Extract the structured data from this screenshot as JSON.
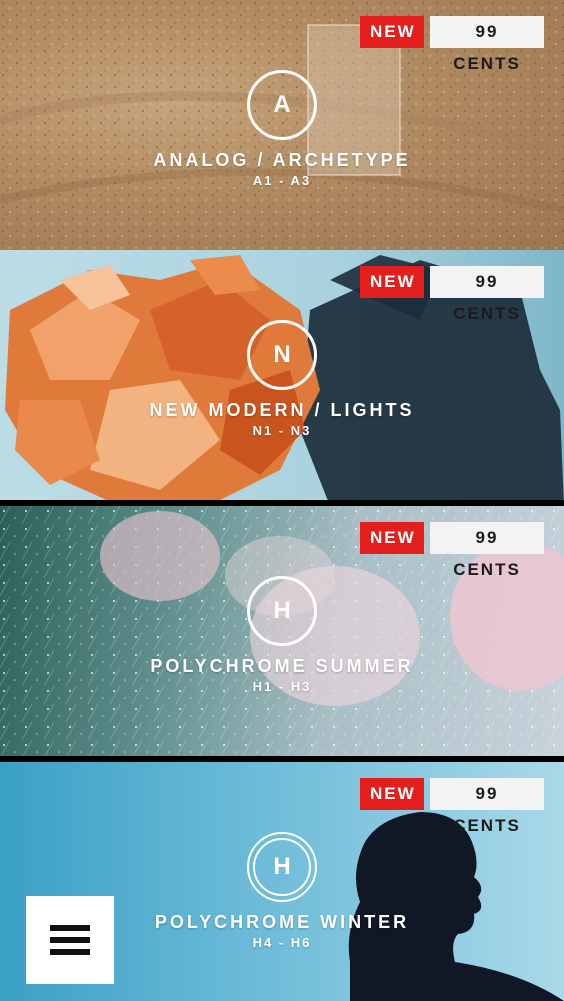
{
  "packs": [
    {
      "letter": "A",
      "title": "ANALOG / ARCHETYPE",
      "range": "A1 - A3",
      "new_label": "NEW",
      "price": "99 CENTS"
    },
    {
      "letter": "N",
      "title": "NEW MODERN / LIGHTS",
      "range": "N1 - N3",
      "new_label": "NEW",
      "price": "99 CENTS"
    },
    {
      "letter": "H",
      "title": "POLYCHROME SUMMER",
      "range": "H1 - H3",
      "new_label": "NEW",
      "price": "99 CENTS"
    },
    {
      "letter": "H",
      "title": "POLYCHROME WINTER",
      "range": "H4 - H6",
      "new_label": "NEW",
      "price": "99 CENTS"
    }
  ],
  "menu": {
    "icon": "hamburger-menu-icon"
  },
  "colors": {
    "new_badge": "#e41d1d",
    "price_badge": "#f3f3f3",
    "overlay_text": "#ffffff"
  }
}
